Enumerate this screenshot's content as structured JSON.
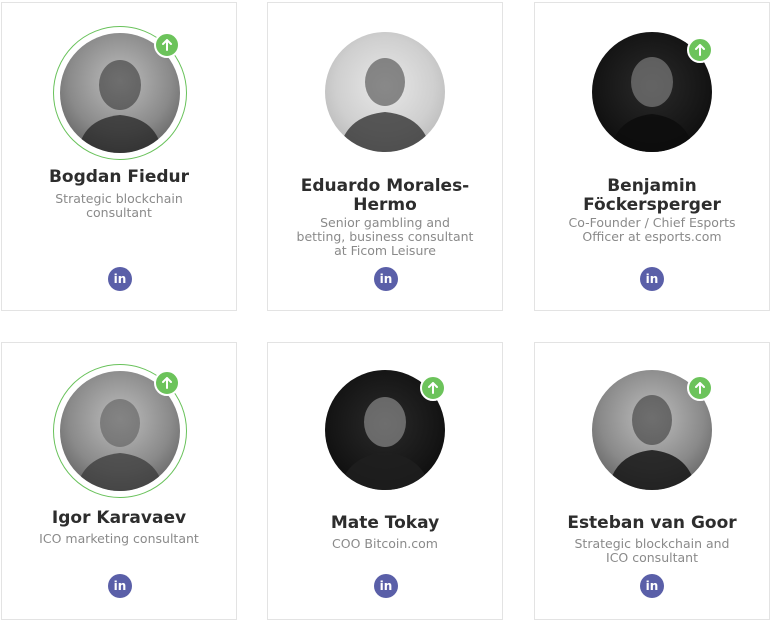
{
  "people": [
    {
      "name": "Bogdan Fiedur",
      "role": "Strategic blockchain consultant",
      "linkedin_label": "in",
      "icon": "arrow-up-icon"
    },
    {
      "name": "Eduardo Morales-Hermo",
      "role": "Senior gambling and betting, business consultant at Ficom Leisure",
      "linkedin_label": "in",
      "icon": null
    },
    {
      "name": "Benjamin Föckersperger",
      "role": "Co-Founder / Chief Esports Officer at esports.com",
      "linkedin_label": "in",
      "icon": "arrow-up-icon"
    },
    {
      "name": "Igor Karavaev",
      "role": "ICO marketing consultant",
      "linkedin_label": "in",
      "icon": "arrow-up-icon"
    },
    {
      "name": "Mate Tokay",
      "role": "COO Bitcoin.com",
      "linkedin_label": "in",
      "icon": "arrow-up-icon"
    },
    {
      "name": "Esteban van Goor",
      "role": "Strategic blockchain and ICO consultant",
      "linkedin_label": "in",
      "icon": "arrow-up-icon"
    }
  ],
  "colors": {
    "accent_green": "#6cc35b",
    "linkedin_blue": "#5a5fa8",
    "name_text": "#2d2d2d",
    "role_text": "#8a8a8a",
    "card_border": "#e3e3e3"
  }
}
